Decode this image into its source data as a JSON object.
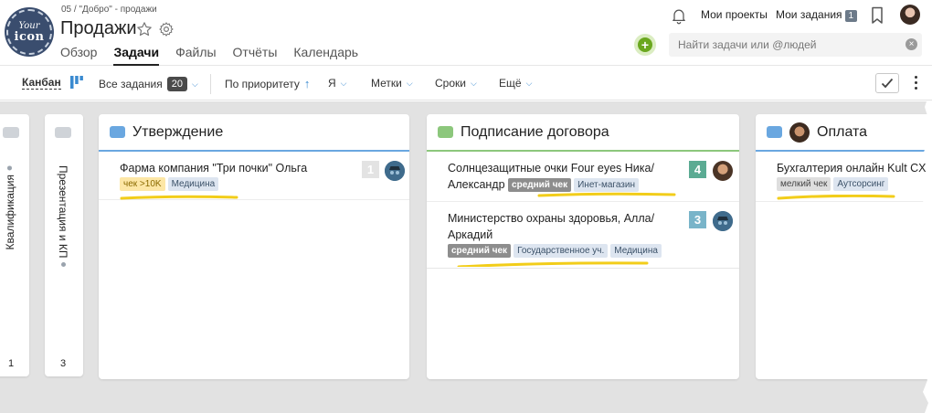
{
  "header": {
    "logo": {
      "line1": "Your",
      "line2": "icon"
    },
    "breadcrumb": "05 / \"Добро\" - продажи",
    "title": "Продажи",
    "tabs": [
      {
        "label": "Обзор",
        "active": false
      },
      {
        "label": "Задачи",
        "active": true
      },
      {
        "label": "Файлы",
        "active": false
      },
      {
        "label": "Отчёты",
        "active": false
      },
      {
        "label": "Календарь",
        "active": false
      }
    ],
    "nav": {
      "my_projects": "Мои проекты",
      "my_tasks": "Мои задания",
      "my_tasks_count": "1"
    },
    "search": {
      "placeholder": "Найти задачи или @людей"
    }
  },
  "toolbar": {
    "view": "Канбан",
    "all_tasks": "Все задания",
    "all_tasks_count": "20",
    "sort": "По приоритету",
    "filter_me": "Я",
    "filter_labels": "Метки",
    "filter_dates": "Сроки",
    "filter_more": "Ещё"
  },
  "board": {
    "collapsed_columns": [
      {
        "title": "Квалификация",
        "count": "1"
      },
      {
        "title": "Презентация и КП",
        "count": "3"
      }
    ],
    "columns": [
      {
        "title": "Утверждение",
        "color": "#6aa7e0",
        "cards": [
          {
            "title": "Фарма компания \"Три почки\" Ольга",
            "priority": "1",
            "priority_color": "#e3e3e3",
            "avatar": "anon",
            "tags": [
              {
                "label": "чек >10K",
                "style": "yellow"
              },
              {
                "label": "Медицина",
                "style": "blue"
              }
            ]
          }
        ]
      },
      {
        "title": "Подписание договора",
        "color": "#8cc77c",
        "cards": [
          {
            "title": "Солнцезащитные очки Four eyes Ника/Александр",
            "priority": "4",
            "priority_color": "#5bab93",
            "avatar": "photo",
            "tags": [
              {
                "label": "средний чек",
                "style": "dark"
              },
              {
                "label": "Инет-магазин",
                "style": "blue"
              }
            ]
          },
          {
            "title": "Министерство охраны здоровья, Алла/ Аркадий",
            "priority": "3",
            "priority_color": "#79b4c9",
            "avatar": "anon",
            "tags": [
              {
                "label": "средний чек",
                "style": "dark"
              },
              {
                "label": "Государственное уч.",
                "style": "blue"
              },
              {
                "label": "Медицина",
                "style": "blue"
              }
            ]
          }
        ]
      },
      {
        "title": "Оплата",
        "color": "#6aa7e0",
        "cards": [
          {
            "title": "Бухгалтерия онлайн Kult CX",
            "priority": "",
            "avatar": "",
            "tags": [
              {
                "label": "мелкий чек",
                "style": "grey"
              },
              {
                "label": "Аутсорсинг",
                "style": "blue"
              }
            ]
          }
        ]
      }
    ]
  }
}
